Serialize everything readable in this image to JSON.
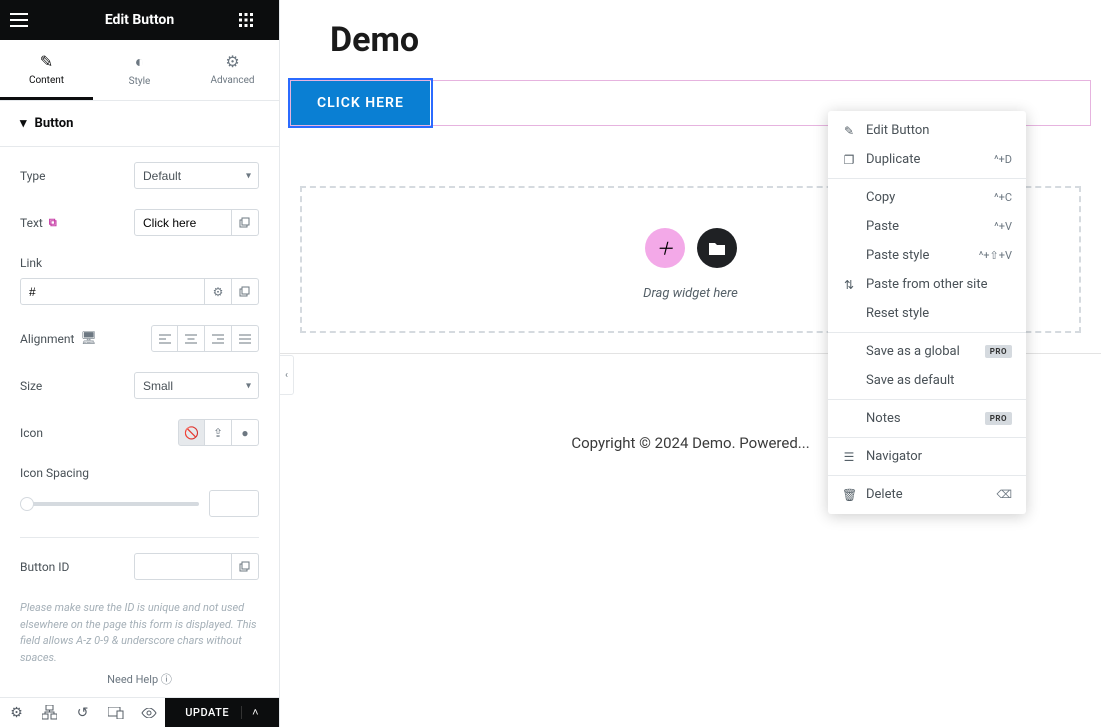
{
  "sidebar": {
    "title": "Edit Button",
    "tabs": {
      "content": "Content",
      "style": "Style",
      "advanced": "Advanced"
    },
    "section_title": "Button",
    "controls": {
      "type": {
        "label": "Type",
        "value": "Default"
      },
      "text": {
        "label": "Text",
        "value": "Click here"
      },
      "link": {
        "label": "Link",
        "value": "#"
      },
      "alignment": {
        "label": "Alignment"
      },
      "size": {
        "label": "Size",
        "value": "Small"
      },
      "icon": {
        "label": "Icon"
      },
      "icon_spacing": {
        "label": "Icon Spacing",
        "value": ""
      },
      "button_id": {
        "label": "Button ID",
        "value": ""
      }
    },
    "help_note": "Please make sure the ID is unique and not used elsewhere on the page this form is displayed. This field allows A-z 0-9 & underscore chars without spaces.",
    "need_help": "Need Help",
    "update": "UPDATE"
  },
  "canvas": {
    "title": "Demo",
    "button_label": "CLICK HERE",
    "drop_text": "Drag widget here",
    "footer": "Copyright © 2024 Demo. Powered..."
  },
  "ctx": {
    "edit": "Edit Button",
    "duplicate": {
      "label": "Duplicate",
      "shortcut": "^+D"
    },
    "copy": {
      "label": "Copy",
      "shortcut": "^+C"
    },
    "paste": {
      "label": "Paste",
      "shortcut": "^+V"
    },
    "paste_style": {
      "label": "Paste style",
      "shortcut": "^+⇧+V"
    },
    "paste_other": "Paste from other site",
    "reset_style": "Reset style",
    "save_global": "Save as a global",
    "save_default": "Save as default",
    "notes": "Notes",
    "navigator": "Navigator",
    "delete": "Delete",
    "pro": "PRO"
  }
}
